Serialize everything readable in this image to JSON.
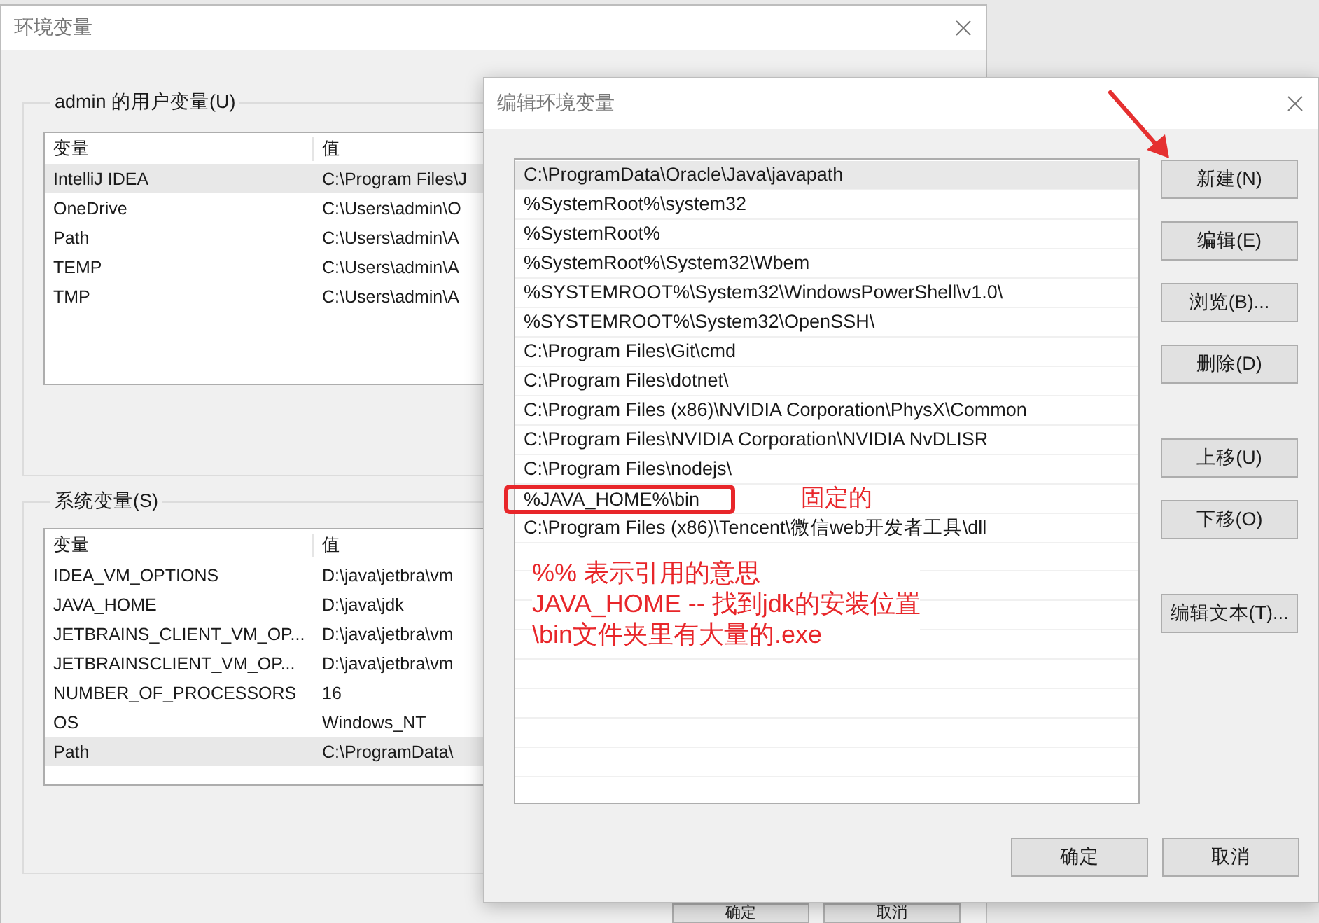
{
  "background_window": {
    "title": "环境变量",
    "user_variables": {
      "label": "admin 的用户变量(U)",
      "columns": [
        "变量",
        "值"
      ],
      "rows": [
        {
          "name": "IntelliJ IDEA",
          "value": "C:\\Program Files\\J",
          "selected": true
        },
        {
          "name": "OneDrive",
          "value": "C:\\Users\\admin\\O",
          "selected": false
        },
        {
          "name": "Path",
          "value": "C:\\Users\\admin\\A",
          "selected": false
        },
        {
          "name": "TEMP",
          "value": "C:\\Users\\admin\\A",
          "selected": false
        },
        {
          "name": "TMP",
          "value": "C:\\Users\\admin\\A",
          "selected": false
        }
      ]
    },
    "system_variables": {
      "label": "系统变量(S)",
      "columns": [
        "变量",
        "值"
      ],
      "rows": [
        {
          "name": "IDEA_VM_OPTIONS",
          "value": "D:\\java\\jetbra\\vm",
          "selected": false
        },
        {
          "name": "JAVA_HOME",
          "value": "D:\\java\\jdk",
          "selected": false
        },
        {
          "name": "JETBRAINS_CLIENT_VM_OP...",
          "value": "D:\\java\\jetbra\\vm",
          "selected": false
        },
        {
          "name": "JETBRAINSCLIENT_VM_OP...",
          "value": "D:\\java\\jetbra\\vm",
          "selected": false
        },
        {
          "name": "NUMBER_OF_PROCESSORS",
          "value": "16",
          "selected": false
        },
        {
          "name": "OS",
          "value": "Windows_NT",
          "selected": false
        },
        {
          "name": "Path",
          "value": "C:\\ProgramData\\",
          "selected": true
        }
      ]
    },
    "buttons": [
      "确定",
      "取消"
    ]
  },
  "edit_dialog": {
    "title": "编辑环境变量",
    "paths": [
      {
        "text": "C:\\ProgramData\\Oracle\\Java\\javapath",
        "selected": true,
        "boxed": false
      },
      {
        "text": "%SystemRoot%\\system32",
        "selected": false,
        "boxed": false
      },
      {
        "text": "%SystemRoot%",
        "selected": false,
        "boxed": false
      },
      {
        "text": "%SystemRoot%\\System32\\Wbem",
        "selected": false,
        "boxed": false
      },
      {
        "text": "%SYSTEMROOT%\\System32\\WindowsPowerShell\\v1.0\\",
        "selected": false,
        "boxed": false
      },
      {
        "text": "%SYSTEMROOT%\\System32\\OpenSSH\\",
        "selected": false,
        "boxed": false
      },
      {
        "text": "C:\\Program Files\\Git\\cmd",
        "selected": false,
        "boxed": false
      },
      {
        "text": "C:\\Program Files\\dotnet\\",
        "selected": false,
        "boxed": false
      },
      {
        "text": "C:\\Program Files (x86)\\NVIDIA Corporation\\PhysX\\Common",
        "selected": false,
        "boxed": false
      },
      {
        "text": "C:\\Program Files\\NVIDIA Corporation\\NVIDIA NvDLISR",
        "selected": false,
        "boxed": false
      },
      {
        "text": "C:\\Program Files\\nodejs\\",
        "selected": false,
        "boxed": false
      },
      {
        "text": "%JAVA_HOME%\\bin",
        "selected": false,
        "boxed": true
      },
      {
        "text": "C:\\Program Files (x86)\\Tencent\\微信web开发者工具\\dll",
        "selected": false,
        "boxed": false
      }
    ],
    "side_buttons": [
      [
        "新建(N)",
        "编辑(E)",
        "浏览(B)...",
        "删除(D)"
      ],
      [
        "上移(U)",
        "下移(O)"
      ],
      [
        "编辑文本(T)..."
      ]
    ],
    "buttons": [
      "确定",
      "取消"
    ]
  },
  "annotations": {
    "box_note": "固定的",
    "notes": [
      "%% 表示引用的意思",
      "JAVA_HOME -- 找到jdk的安装位置",
      "\\bin文件夹里有大量的.exe"
    ]
  }
}
